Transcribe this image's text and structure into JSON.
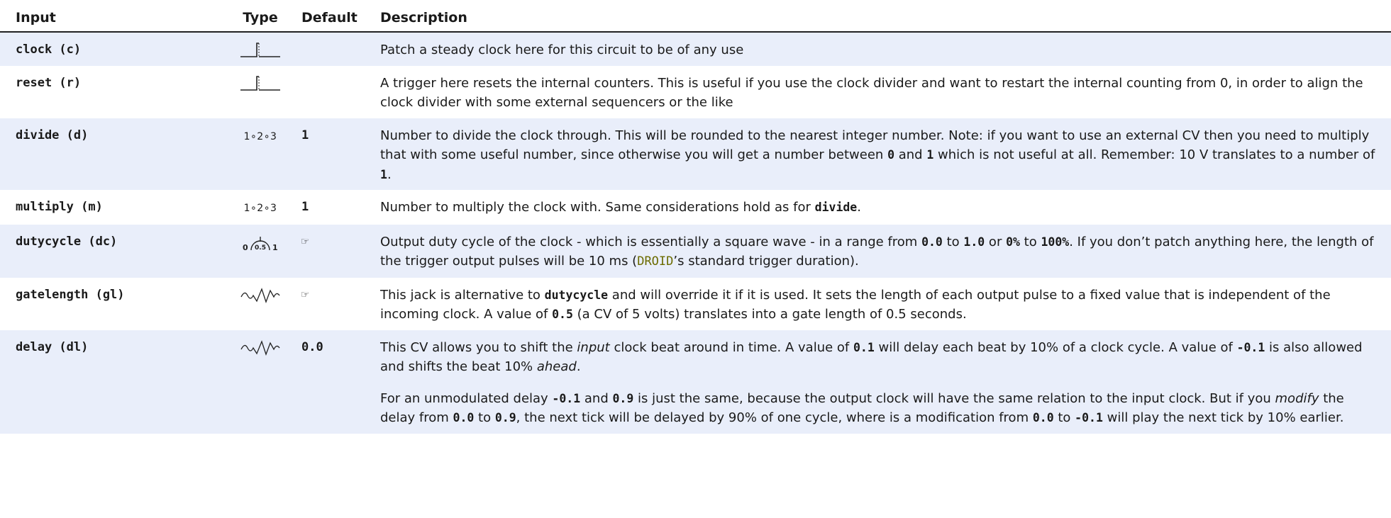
{
  "headers": {
    "input": "Input",
    "type": "Type",
    "default": "Default",
    "description": "Description"
  },
  "type_icons": {
    "trigger": "trigger-icon",
    "integer": "1∘2∘3",
    "fraction": "fraction-knob-icon",
    "cv": "cv-wave-icon",
    "see_desc": "☞"
  },
  "rows": [
    {
      "name": "clock (c)",
      "default": "",
      "desc": [
        "Patch a steady clock here for this circuit to be of any use"
      ]
    },
    {
      "name": "reset (r)",
      "default": "",
      "desc": [
        "A trigger here resets the internal counters.  This is useful if you use the clock divider and want to restart the internal counting from 0, in order to align the clock divider with some external sequencers or the like"
      ]
    },
    {
      "name": "divide (d)",
      "default": "1",
      "desc": [
        "Number to divide the clock through.  This will be rounded to the nearest integer number.  Note: if you want to use an external CV then you need to multiply that with some useful number, since otherwise you will get a number between ",
        "0",
        " and ",
        "1",
        " which is not useful at all.  Remember:  10 V translates to a number of ",
        "1",
        "."
      ]
    },
    {
      "name": "multiply (m)",
      "default": "1",
      "desc": [
        "Number to multiply the clock with.  Same considerations hold as for ",
        "divide",
        "."
      ]
    },
    {
      "name": "dutycycle (dc)",
      "default": "☞",
      "knob": {
        "min": "0",
        "mid": "0.5",
        "max": "1"
      },
      "desc": [
        "Output duty cycle of the clock - which is essentially a square wave - in a range from ",
        "0.0",
        " to ",
        "1.0",
        " or ",
        "0%",
        " to ",
        "100%",
        ".  If you don’t patch anything here, the length of the trigger output pulses will be 10 ms (",
        "DROID",
        "’s standard trigger duration)."
      ]
    },
    {
      "name": "gatelength (gl)",
      "default": "☞",
      "desc": [
        "This jack is alternative to ",
        "dutycycle",
        " and will override it if it is used.  It sets the length of each output pulse to a fixed value that is independent of the incoming clock.  A value of ",
        "0.5",
        " (a CV of 5 volts) translates into a gate length of 0.5 seconds."
      ]
    },
    {
      "name": "delay (dl)",
      "default": "0.0",
      "desc": [
        "This CV allows you to shift the ",
        "input",
        " clock beat around in time.  A value of ",
        "0.1",
        " will delay each beat by 10% of a clock cycle.  A value of ",
        "-0.1",
        " is also allowed and shifts the beat 10% ",
        "ahead",
        "."
      ],
      "desc2": [
        "For an unmodulated delay ",
        "-0.1",
        " and ",
        "0.9",
        " is just the same, because the output clock will have the same relation to the input clock.  But if you ",
        "modify",
        " the delay from ",
        "0.0",
        " to ",
        "0.9",
        ", the next tick will be delayed by 90% of one cycle, where is a modification from ",
        "0.0",
        " to ",
        "-0.1",
        " will play the next tick by 10% earlier."
      ]
    }
  ]
}
